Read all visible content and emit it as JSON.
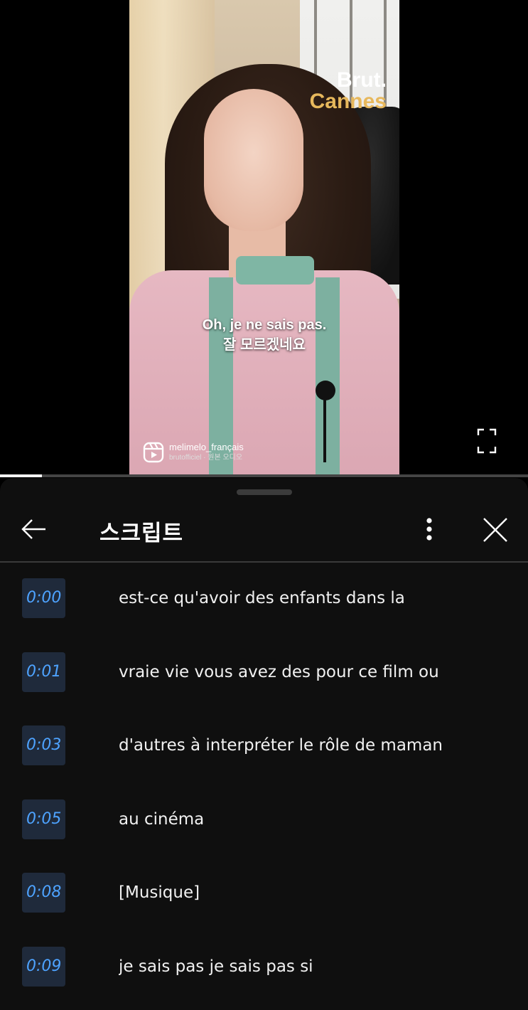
{
  "video": {
    "brand_top": "Brut.",
    "brand_sub": "Cannes",
    "subtitle_fr": "Oh, je ne sais pas.",
    "subtitle_ko": "잘 모르겠네요",
    "reel_user": "melimelo_français",
    "reel_audio": "brutofficiel · 원본 오디오",
    "progress": 0.08,
    "colors": {
      "background": "#000000",
      "brand_accent": "#e7b85c"
    }
  },
  "sheet": {
    "title": "스크립트",
    "back_icon": "arrow-left-icon",
    "more_icon": "more-vertical-icon",
    "close_icon": "close-icon",
    "colors": {
      "background": "#0f0f0f",
      "timestamp_text": "#4ea3ff",
      "timestamp_bg": "#1f2a3b",
      "text": "#f1f1f1"
    }
  },
  "transcript": [
    {
      "time": "0:00",
      "text": "est-ce qu'avoir des enfants dans la"
    },
    {
      "time": "0:01",
      "text": "vraie vie vous avez des pour ce film ou"
    },
    {
      "time": "0:03",
      "text": "d'autres à interpréter le rôle de maman"
    },
    {
      "time": "0:05",
      "text": "au cinéma"
    },
    {
      "time": "0:08",
      "text": "[Musique]"
    },
    {
      "time": "0:09",
      "text": "je sais pas je sais pas si"
    }
  ]
}
